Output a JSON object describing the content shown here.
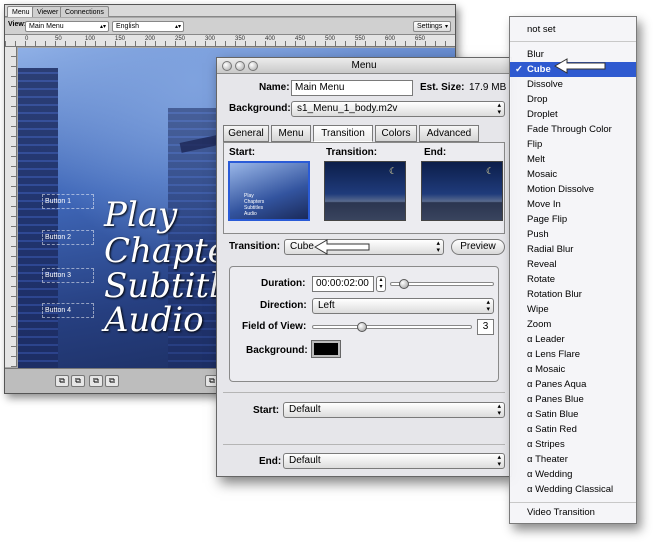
{
  "back_window": {
    "tabs": [
      "Menu",
      "Viewer",
      "Connections"
    ],
    "view_label": "View:",
    "view_select": "Main Menu",
    "language_select": "English",
    "settings_label": "Settings",
    "ruler_marks": [
      "0",
      "50",
      "100",
      "150",
      "200",
      "250",
      "300",
      "350",
      "400",
      "450",
      "500",
      "550",
      "600",
      "650"
    ],
    "menu_lines": [
      "Play",
      "Chapters",
      "Subtitles",
      "Audio"
    ],
    "button_labels": [
      "Button 1",
      "Button 2",
      "Button 3",
      "Button 4"
    ]
  },
  "inspector": {
    "title": "Menu",
    "name_label": "Name:",
    "name_value": "Main Menu",
    "est_size_label": "Est. Size:",
    "est_size_value": "17.9 MB",
    "background_label": "Background:",
    "background_value": "s1_Menu_1_body.m2v",
    "tabs": [
      "General",
      "Menu",
      "Transition",
      "Colors",
      "Advanced"
    ],
    "active_tab": "Transition",
    "preview_heads": [
      "Start:",
      "Transition:",
      "End:"
    ],
    "start_thumb_lines": [
      "Play",
      "Chapters",
      "Subtitles",
      "Audio"
    ],
    "transition_label": "Transition:",
    "transition_value": "Cube",
    "preview_button": "Preview",
    "duration_label": "Duration:",
    "duration_value": "00:00:02:00",
    "duration_level": 0.1,
    "direction_label": "Direction:",
    "direction_value": "Left",
    "fov_label": "Field of View:",
    "fov_value": "3",
    "fov_level": 0.3,
    "bg_color_label": "Background:",
    "bg_color": "#000000",
    "start_label": "Start:",
    "start_value": "Default",
    "end_label": "End:",
    "end_value": "Default"
  },
  "dropdown": {
    "top_item": "not set",
    "selected": "Cube",
    "items": [
      "Blur",
      "Cube",
      "Dissolve",
      "Drop",
      "Droplet",
      "Fade Through Color",
      "Flip",
      "Melt",
      "Mosaic",
      "Motion Dissolve",
      "Move In",
      "Page Flip",
      "Push",
      "Radial Blur",
      "Reveal",
      "Rotate",
      "Rotation Blur",
      "Wipe",
      "Zoom",
      "α Leader",
      "α Lens Flare",
      "α Mosaic",
      "α Panes Aqua",
      "α Panes Blue",
      "α Satin Blue",
      "α Satin Red",
      "α Stripes",
      "α Theater",
      "α Wedding",
      "α Wedding Classical"
    ],
    "bottom_item": "Video Transition",
    "check_mark": "✓"
  },
  "colors": {
    "selection": "#2f5ad0",
    "window_bg": "#e6e6ea"
  }
}
